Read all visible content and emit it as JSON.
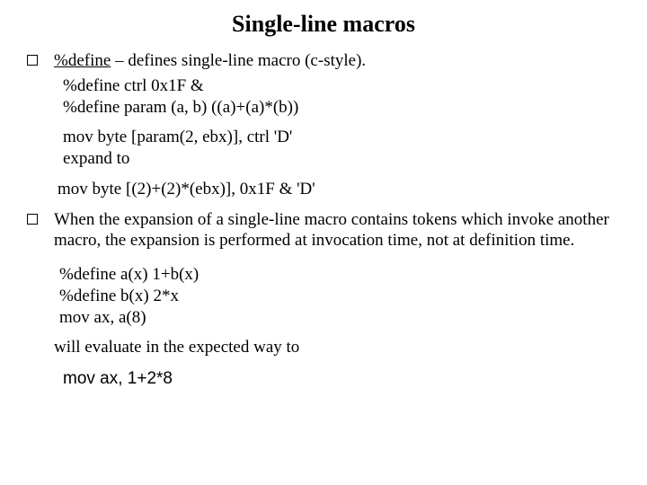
{
  "title": "Single-line macros",
  "bullet1": {
    "keyword": "%define",
    "rest": " – defines single-line macro (c-style)."
  },
  "code1": {
    "l1": "%define ctrl 0x1F &",
    "l2": "%define param (a, b) ((a)+(a)*(b))"
  },
  "code2": {
    "l1": "mov byte [param(2, ebx)], ctrl 'D'",
    "l2": "expand to"
  },
  "expanded": "mov byte [(2)+(2)*(ebx)], 0x1F & 'D'",
  "bullet2": "When the expansion of a single-line macro contains tokens which invoke another macro, the expansion is performed at invocation time, not at definition time.",
  "code3": {
    "l1": "%define a(x) 1+b(x)",
    "l2": "%define b(x) 2*x",
    "l3": "mov ax, a(8)"
  },
  "eval_text": "will evaluate in the expected way to",
  "result": "mov ax, 1+2*8"
}
